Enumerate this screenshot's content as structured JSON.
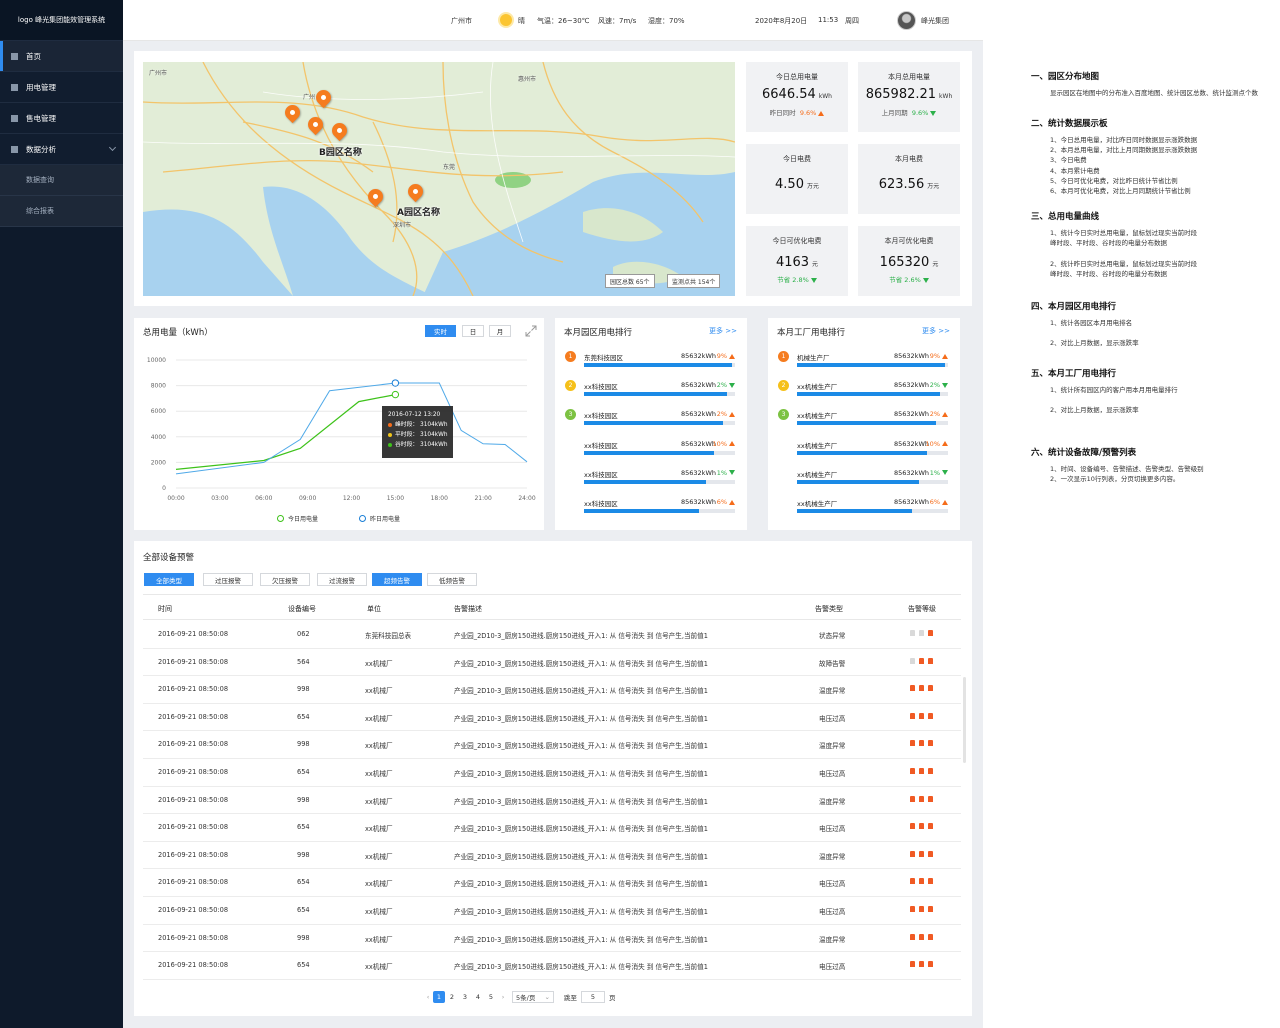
{
  "brand": "logo  峰光集团能效管理系统",
  "sidebar": {
    "items": [
      {
        "label": "首页"
      },
      {
        "label": "用电管理"
      },
      {
        "label": "售电管理"
      },
      {
        "label": "数据分析"
      }
    ],
    "sub_items": [
      {
        "label": "数据查询"
      },
      {
        "label": "综合报表"
      }
    ]
  },
  "topbar": {
    "city": "广州市",
    "weather": "晴",
    "temp": "气温：26~30℃",
    "wind": "风速：7m/s",
    "humidity": "湿度：70%",
    "date": "2020年8月20日",
    "time": "11:53",
    "weekday": "周四",
    "user": "峰光集团"
  },
  "map": {
    "city_label": "广州市",
    "park_b": "B园区名称",
    "park_a": "A园区名称",
    "place_1": "广州",
    "place_2": "东莞",
    "place_3": "深圳市",
    "place_4": "惠州市",
    "park_total": "园区总数   65个",
    "monitor_total": "监测点共   154个"
  },
  "stats": [
    {
      "title": "今日总用电量",
      "value": "6646.54",
      "unit": "kWh",
      "sub_label": "昨日同时",
      "sub_value": "9.6%",
      "trend": "up"
    },
    {
      "title": "本月总用电量",
      "value": "865982.21",
      "unit": "kWh",
      "sub_label": "上月同期",
      "sub_value": "9.6%",
      "trend": "down"
    },
    {
      "title": "今日电费",
      "value": "4.50",
      "unit": "万元",
      "sub_label": "",
      "sub_value": "",
      "trend": ""
    },
    {
      "title": "本月电费",
      "value": "623.56",
      "unit": "万元",
      "sub_label": "",
      "sub_value": "",
      "trend": ""
    },
    {
      "title": "今日可优化电费",
      "value": "4163",
      "unit": "元",
      "sub_label": "节省",
      "sub_value": "2.8%",
      "trend": "down"
    },
    {
      "title": "本月可优化电费",
      "value": "165320",
      "unit": "元",
      "sub_label": "节省",
      "sub_value": "2.6%",
      "trend": "down"
    }
  ],
  "chart_panel": {
    "title": "总用电量（kWh）",
    "btn_realtime": "实时",
    "btn_day": "日",
    "btn_month": "月",
    "tooltip": {
      "time": "2016-07-12   13:20",
      "peak": "峰时段：   3104kWh",
      "flat": "平时段：   3104kWh",
      "valley": "谷时段：   3104kWh"
    }
  },
  "chart_data": {
    "type": "line",
    "x": [
      "00:00",
      "03:00",
      "06:00",
      "09:00",
      "12:00",
      "15:00",
      "18:00",
      "21:00",
      "24:00"
    ],
    "y_ticks": [
      0,
      2000,
      4000,
      6000,
      8000,
      10000
    ],
    "ylim": [
      0,
      10000
    ],
    "series": [
      {
        "name": "今日用电量",
        "color": "#3ec21a",
        "points": [
          [
            0,
            1450
          ],
          [
            6,
            2150
          ],
          [
            8.5,
            3100
          ],
          [
            12.5,
            6750
          ],
          [
            15,
            7300
          ]
        ]
      },
      {
        "name": "昨日用电量",
        "color": "#4fa9e8",
        "points": [
          [
            0,
            1100
          ],
          [
            6,
            2000
          ],
          [
            8.5,
            3800
          ],
          [
            10.5,
            7600
          ],
          [
            15,
            8200
          ],
          [
            18,
            8200
          ],
          [
            19.5,
            4500
          ],
          [
            21,
            3450
          ],
          [
            22.5,
            3400
          ],
          [
            24,
            2050
          ]
        ]
      }
    ],
    "highlight_x": 15
  },
  "park_rank": {
    "title": "本月园区用电排行",
    "more": "更多 >>",
    "rows": [
      {
        "rank": "1",
        "name": "东莞科技园区",
        "value": "85632kWh",
        "pct": "9%",
        "trend": "up",
        "fill": 0.98
      },
      {
        "rank": "2",
        "name": "xx科技园区",
        "value": "85632kWh",
        "pct": "2%",
        "trend": "down",
        "fill": 0.95
      },
      {
        "rank": "3",
        "name": "xx科技园区",
        "value": "85632kWh",
        "pct": "2%",
        "trend": "up",
        "fill": 0.92
      },
      {
        "rank": "",
        "name": "xx科技园区",
        "value": "85632kWh",
        "pct": "10%",
        "trend": "up",
        "fill": 0.86
      },
      {
        "rank": "",
        "name": "xx科技园区",
        "value": "85632kWh",
        "pct": "1%",
        "trend": "down",
        "fill": 0.81
      },
      {
        "rank": "",
        "name": "xx科技园区",
        "value": "85632kWh",
        "pct": "6%",
        "trend": "up",
        "fill": 0.76
      }
    ]
  },
  "factory_rank": {
    "title": "本月工厂用电排行",
    "more": "更多 >>",
    "rows": [
      {
        "rank": "1",
        "name": "机械生产厂",
        "value": "85632kWh",
        "pct": "9%",
        "trend": "up",
        "fill": 0.98
      },
      {
        "rank": "2",
        "name": "xx机械生产厂",
        "value": "85632kWh",
        "pct": "2%",
        "trend": "down",
        "fill": 0.95
      },
      {
        "rank": "3",
        "name": "xx机械生产厂",
        "value": "85632kWh",
        "pct": "2%",
        "trend": "up",
        "fill": 0.92
      },
      {
        "rank": "",
        "name": "xx机械生产厂",
        "value": "85632kWh",
        "pct": "10%",
        "trend": "up",
        "fill": 0.86
      },
      {
        "rank": "",
        "name": "xx机械生产厂",
        "value": "85632kWh",
        "pct": "1%",
        "trend": "down",
        "fill": 0.81
      },
      {
        "rank": "",
        "name": "xx机械生产厂",
        "value": "85632kWh",
        "pct": "6%",
        "trend": "up",
        "fill": 0.76
      }
    ]
  },
  "alarms": {
    "title": "全部设备预警",
    "filters": [
      "全部类型",
      "过压报警",
      "欠压报警",
      "过流报警",
      "超频告警",
      "低频告警"
    ],
    "headers": [
      "时间",
      "设备编号",
      "单位",
      "告警描述",
      "告警类型",
      "告警等级"
    ],
    "rows": [
      {
        "time": "2016-09-21    08:50:08",
        "id": "062",
        "unit": "东莞科技园总表",
        "desc": "产业园_2D10-3_厨房150进线.厨房150进线_开入1: 从 信号消失 到 信号产生,当前值1",
        "type": "状态异常",
        "level": 1
      },
      {
        "time": "2016-09-21    08:50:08",
        "id": "564",
        "unit": "xx机械厂",
        "desc": "产业园_2D10-3_厨房150进线.厨房150进线_开入1: 从 信号消失 到 信号产生,当前值1",
        "type": "故障告警",
        "level": 2
      },
      {
        "time": "2016-09-21    08:50:08",
        "id": "998",
        "unit": "xx机械厂",
        "desc": "产业园_2D10-3_厨房150进线.厨房150进线_开入1: 从 信号消失 到 信号产生,当前值1",
        "type": "温度异常",
        "level": 3
      },
      {
        "time": "2016-09-21    08:50:08",
        "id": "654",
        "unit": "xx机械厂",
        "desc": "产业园_2D10-3_厨房150进线.厨房150进线_开入1: 从 信号消失 到 信号产生,当前值1",
        "type": "电压过高",
        "level": 3
      },
      {
        "time": "2016-09-21    08:50:08",
        "id": "998",
        "unit": "xx机械厂",
        "desc": "产业园_2D10-3_厨房150进线.厨房150进线_开入1: 从 信号消失 到 信号产生,当前值1",
        "type": "温度异常",
        "level": 3
      },
      {
        "time": "2016-09-21    08:50:08",
        "id": "654",
        "unit": "xx机械厂",
        "desc": "产业园_2D10-3_厨房150进线.厨房150进线_开入1: 从 信号消失 到 信号产生,当前值1",
        "type": "电压过高",
        "level": 3
      },
      {
        "time": "2016-09-21    08:50:08",
        "id": "998",
        "unit": "xx机械厂",
        "desc": "产业园_2D10-3_厨房150进线.厨房150进线_开入1: 从 信号消失 到 信号产生,当前值1",
        "type": "温度异常",
        "level": 3
      },
      {
        "time": "2016-09-21    08:50:08",
        "id": "654",
        "unit": "xx机械厂",
        "desc": "产业园_2D10-3_厨房150进线.厨房150进线_开入1: 从 信号消失 到 信号产生,当前值1",
        "type": "电压过高",
        "level": 3
      },
      {
        "time": "2016-09-21    08:50:08",
        "id": "998",
        "unit": "xx机械厂",
        "desc": "产业园_2D10-3_厨房150进线.厨房150进线_开入1: 从 信号消失 到 信号产生,当前值1",
        "type": "温度异常",
        "level": 3
      },
      {
        "time": "2016-09-21    08:50:08",
        "id": "654",
        "unit": "xx机械厂",
        "desc": "产业园_2D10-3_厨房150进线.厨房150进线_开入1: 从 信号消失 到 信号产生,当前值1",
        "type": "电压过高",
        "level": 3
      },
      {
        "time": "2016-09-21    08:50:08",
        "id": "654",
        "unit": "xx机械厂",
        "desc": "产业园_2D10-3_厨房150进线.厨房150进线_开入1: 从 信号消失 到 信号产生,当前值1",
        "type": "电压过高",
        "level": 3
      },
      {
        "time": "2016-09-21    08:50:08",
        "id": "998",
        "unit": "xx机械厂",
        "desc": "产业园_2D10-3_厨房150进线.厨房150进线_开入1: 从 信号消失 到 信号产生,当前值1",
        "type": "温度异常",
        "level": 3
      },
      {
        "time": "2016-09-21    08:50:08",
        "id": "654",
        "unit": "xx机械厂",
        "desc": "产业园_2D10-3_厨房150进线.厨房150进线_开入1: 从 信号消失 到 信号产生,当前值1",
        "type": "电压过高",
        "level": 3
      }
    ],
    "pager": {
      "pages": [
        "1",
        "2",
        "3",
        "4",
        "5"
      ],
      "per_page": "5条/页",
      "goto": "跳至",
      "goto_value": "5",
      "page_unit": "页"
    }
  },
  "notes": [
    {
      "heading": "一、园区分布地图",
      "lines": [
        "显示园区在地图中的分布准入百度地图、统计园区总数、统计监测点个数"
      ]
    },
    {
      "heading": "二、统计数据展示板",
      "lines": [
        "1、今日总用电量，对比昨日同时数据显示涨跌数据",
        "2、本月总用电量，对比上月同期数据显示涨跌数据",
        "3、今日电费",
        "4、本月累计电费",
        "5、今日可优化电费，对比昨日统计节省比例",
        "6、本月可优化电费，对比上月同期统计节省比例"
      ]
    },
    {
      "heading": "三、总用电量曲线",
      "lines": [
        "1、统计今日实时总用电量，鼠标划过现实当前时段",
        "峰时段、平时段、谷时段的电量分布数据",
        "",
        "2、统计昨日实时总用电量，鼠标划过现实当前时段",
        "峰时段、平时段、谷时段的电量分布数据"
      ]
    },
    {
      "heading": "四、本月园区用电排行",
      "lines": [
        "1、统计各园区本月用电排名",
        "",
        "2、对比上月数据，显示涨跌率"
      ]
    },
    {
      "heading": "五、本月工厂用电排行",
      "lines": [
        "1、统计所有园区内的客户用本月用电量排行",
        "",
        "2、对比上月数据，显示涨跌率"
      ]
    },
    {
      "heading": "六、统计设备故障/预警列表",
      "lines": [
        "1、时间、设备编号、告警描述、告警类型、告警级别",
        "2、一次显示10行列表，分页切换更多内容。"
      ]
    }
  ]
}
